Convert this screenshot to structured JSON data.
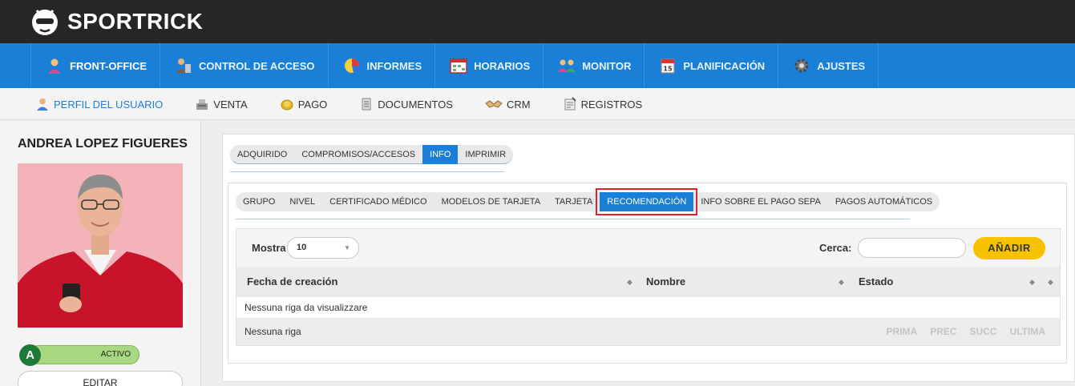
{
  "brand": {
    "name": "SPORTRICK"
  },
  "main_nav": [
    {
      "label": "FRONT-OFFICE",
      "icon": "user-icon",
      "active": true
    },
    {
      "label": "CONTROL DE ACCESO",
      "icon": "access-icon"
    },
    {
      "label": "INFORMES",
      "icon": "pie-chart-icon"
    },
    {
      "label": "HORARIOS",
      "icon": "calendar-grid-icon"
    },
    {
      "label": "MONITOR",
      "icon": "group-icon"
    },
    {
      "label": "PLANIFICACIÓN",
      "icon": "calendar-icon"
    },
    {
      "label": "AJUSTES",
      "icon": "gear-icon"
    }
  ],
  "sub_nav": [
    {
      "label": "PERFIL DEL USUARIO",
      "icon": "profile-icon",
      "active": true
    },
    {
      "label": "VENTA",
      "icon": "cash-register-icon"
    },
    {
      "label": "PAGO",
      "icon": "coins-icon"
    },
    {
      "label": "DOCUMENTOS",
      "icon": "document-icon"
    },
    {
      "label": "CRM",
      "icon": "handshake-icon"
    },
    {
      "label": "REGISTROS",
      "icon": "log-icon"
    }
  ],
  "profile": {
    "name": "ANDREA LOPEZ FIGUERES",
    "status_letter": "A",
    "status": "ACTIVO",
    "edit_label": "EDITAR"
  },
  "tabs_top": [
    {
      "label": "ADQUIRIDO"
    },
    {
      "label": "COMPROMISOS/ACCESOS"
    },
    {
      "label": "INFO",
      "active": true
    },
    {
      "label": "IMPRIMIR"
    }
  ],
  "tabs_info": [
    {
      "label": "GRUPO"
    },
    {
      "label": "NIVEL"
    },
    {
      "label": "CERTIFICADO MÉDICO"
    },
    {
      "label": "MODELOS DE TARJETA"
    },
    {
      "label": "TARJETA"
    },
    {
      "label": "RECOMENDACIÓN",
      "active": true
    },
    {
      "label": "INFO SOBRE EL PAGO SEPA"
    },
    {
      "label": "PAGOS AUTOMÁTICOS"
    }
  ],
  "table": {
    "show_label": "Mostra",
    "show_value": "10",
    "search_label": "Cerca:",
    "search_value": "",
    "add_label": "AÑADIR",
    "columns": [
      "Fecha de creación",
      "Nombre",
      "Estado"
    ],
    "empty_message": "Nessuna riga da visualizzare",
    "footer_info": "Nessuna riga",
    "pager": [
      "PRIMA",
      "PREC",
      "SUCC",
      "ULTIMA"
    ]
  },
  "colors": {
    "topbar": "#262626",
    "nav_blue": "#1a7fd6",
    "active_green": "#a9d883",
    "status_circle": "#1f7a3a",
    "add_yellow": "#f7c300",
    "highlight_red": "#e0222a"
  }
}
